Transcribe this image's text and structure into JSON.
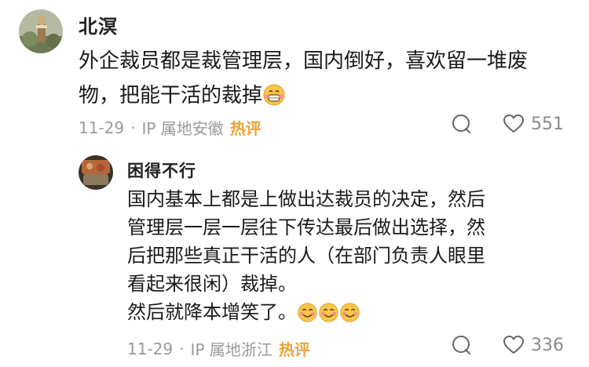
{
  "comments": [
    {
      "username": "北溟",
      "text": "外企裁员都是裁管理层，国内倒好，喜欢留一堆废物，把能干活的裁掉",
      "date": "11-29",
      "sep": "·",
      "location": "IP 属地安徽",
      "badge": "热评",
      "likes": "551",
      "emoji": "grinning-sweat-emoji"
    },
    {
      "username": "困得不行",
      "text_lines": [
        "国内基本上都是上做出达裁员的决定，然后",
        "管理层一层一层往下传达最后做出选择，然",
        "后把那些真正干活的人（在部门负责人眼里",
        "看起来很闲）裁掉。",
        "然后就降本增笑了。"
      ],
      "date": "11-29",
      "sep": "·",
      "location": "IP 属地浙江",
      "badge": "热评",
      "likes": "336",
      "emoji": "smiling-emoji"
    }
  ],
  "icons": {
    "comment": "comment-bubble-icon",
    "like": "heart-icon"
  },
  "colors": {
    "badge": "#e8a43a",
    "meta": "#9a9a9a",
    "text": "#1a1a1a"
  }
}
